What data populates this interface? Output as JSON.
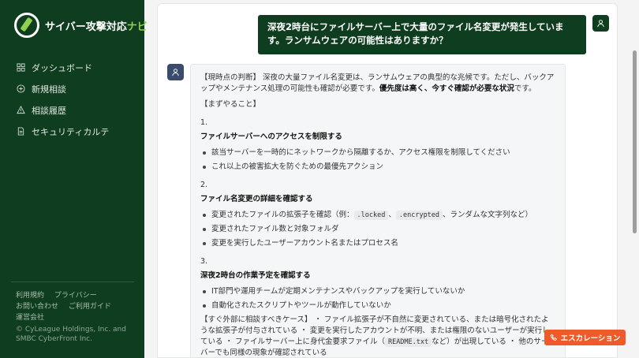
{
  "sidebar": {
    "logo": {
      "text": "サイバー攻撃対応",
      "accent": "ナビ"
    },
    "items": [
      {
        "label": "ダッシュボード",
        "icon": "grid-icon"
      },
      {
        "label": "新規相談",
        "icon": "plus-circle-icon"
      },
      {
        "label": "相談履歴",
        "icon": "warning-icon"
      },
      {
        "label": "セキュリティカルテ",
        "icon": "document-icon"
      }
    ],
    "footer": {
      "links": [
        "利用規約",
        "プライバシー",
        "お問い合わせ",
        "ご利用ガイド",
        "運営会社"
      ],
      "copyright": "© CyLeague Holdings, Inc. and SMBC CyberFront Inc."
    }
  },
  "chat": {
    "user_message": "深夜2時台にファイルサーバー上で大量のファイル名変更が発生しています。ランサムウェアの可能性はありますか？",
    "answer": {
      "judgment_lead": "【現時点の判断】 深夜の大量ファイル名変更は、ランサムウェアの典型的な兆候です。ただし、バックアップやメンテナンス処理の可能性も確認が必要です。",
      "judgment_bold": "優先度は高く、今すぐ確認が必要な状況",
      "judgment_tail": "です。",
      "todo_heading": "【まずやること】",
      "steps": [
        {
          "num": "1.",
          "title": "ファイルサーバーへのアクセスを制限する",
          "items": [
            "該当サーバーを一時的にネットワークから隔離するか、アクセス権限を制限してください",
            "これ以上の被害拡大を防ぐための最優先アクション"
          ]
        },
        {
          "num": "2.",
          "title": "ファイル名変更の詳細を確認する",
          "item_ext": {
            "pre": "変更されたファイルの拡張子を確認（例：",
            "code1": ".locked",
            "sep": "、",
            "code2": ".encrypted",
            "post": "、ランダムな文字列など）"
          },
          "items": [
            "変更されたファイル数と対象フォルダ",
            "変更を実行したユーザーアカウント名またはプロセス名"
          ]
        },
        {
          "num": "3.",
          "title": "深夜2時台の作業予定を確認する",
          "items": [
            "IT部門や運用チームが定期メンテナンスやバックアップを実行していないか",
            "自動化されたスクリプトやツールが動作していないか"
          ]
        }
      ],
      "consult": {
        "pre": "【すぐ外部に相談すべきケース】 ・ ファイル拡張子が不自然に変更されている、または暗号化されたような拡張子が付与されている ・ 変更を実行したアカウントが不明、または権限のないユーザーが実行している ・ ファイルサーバー上に身代金要求ファイル（",
        "code": "README.txt",
        "post": "など）が出現している ・ 他のサーバーでも同様の現象が確認されている"
      }
    }
  },
  "escalate_label": "エスカレーション",
  "colors": {
    "brand_dark": "#0f3d1f",
    "brand_accent": "#8fd14f",
    "escalate": "#ef5a2a"
  }
}
